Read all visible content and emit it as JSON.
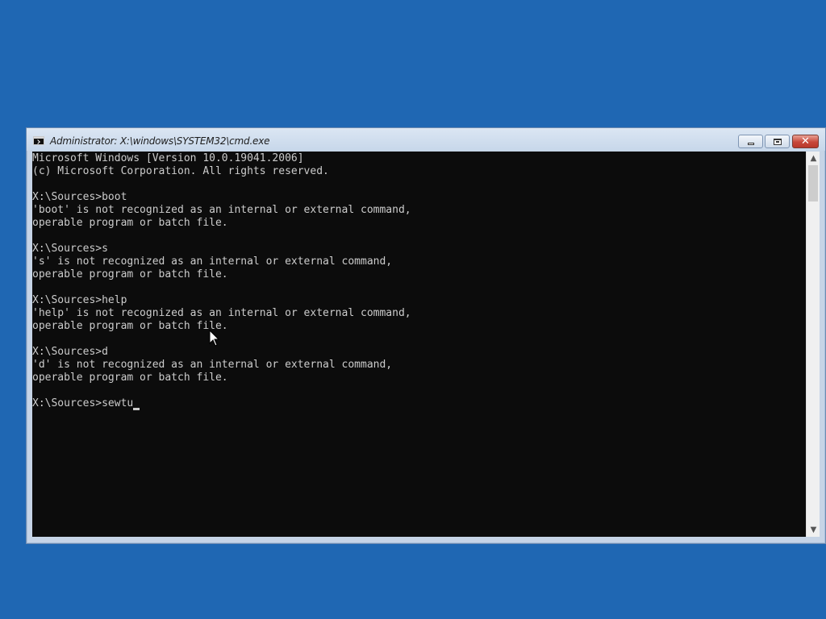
{
  "window": {
    "title": "Administrator: X:\\windows\\SYSTEM32\\cmd.exe",
    "controls": {
      "minimize": "minimize",
      "maximize": "maximize",
      "close": "✕"
    }
  },
  "console": {
    "lines": [
      "Microsoft Windows [Version 10.0.19041.2006]",
      "(c) Microsoft Corporation. All rights reserved.",
      "",
      "X:\\Sources>boot",
      "'boot' is not recognized as an internal or external command,",
      "operable program or batch file.",
      "",
      "X:\\Sources>s",
      "'s' is not recognized as an internal or external command,",
      "operable program or batch file.",
      "",
      "X:\\Sources>help",
      "'help' is not recognized as an internal or external command,",
      "operable program or batch file.",
      "",
      "X:\\Sources>d",
      "'d' is not recognized as an internal or external command,",
      "operable program or batch file.",
      ""
    ],
    "prompt": "X:\\Sources>",
    "current_input": "sewtu"
  },
  "scrollbar": {
    "up_arrow": "▲",
    "down_arrow": "▼"
  },
  "colors": {
    "desktop": "#1f67b3",
    "console_bg": "#0c0c0c",
    "console_text": "#cccccc",
    "close_button": "#c7473a"
  }
}
